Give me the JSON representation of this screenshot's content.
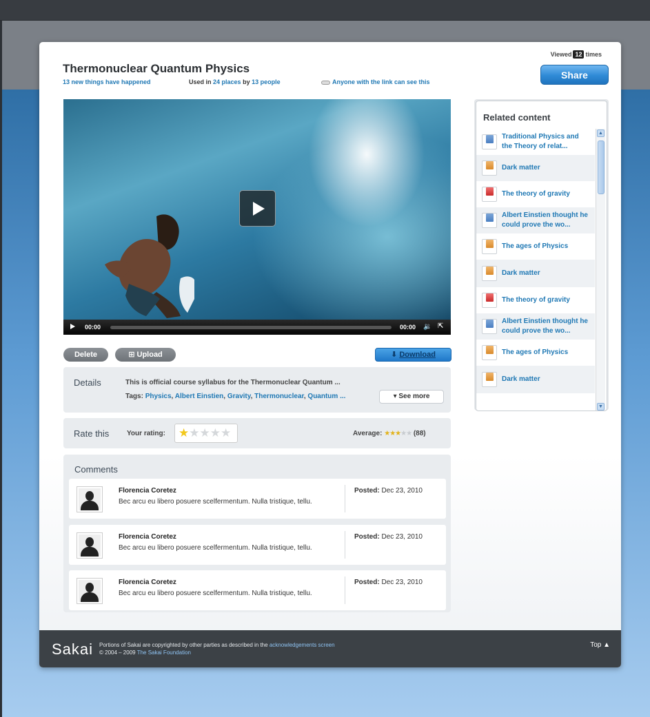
{
  "header": {
    "title": "Thermonuclear Quantum Physics",
    "new_things": "13 new things have happened",
    "used_in_prefix": "Used in",
    "used_in_places": "24 places",
    "used_by_prefix": "by",
    "used_by_people": "13 people",
    "visibility": "Anyone with the link can see this",
    "viewed_prefix": "Viewed",
    "viewed_count": "12",
    "viewed_suffix": "times",
    "share_label": "Share"
  },
  "video": {
    "current_time": "00:00",
    "duration": "00:00",
    "progress": 0
  },
  "actions": {
    "delete_label": "Delete",
    "upload_label": "Upload",
    "download_label": "Download"
  },
  "details": {
    "label": "Details",
    "description": "This is official course syllabus for the Thermonuclear Quantum ...",
    "tags_label": "Tags:",
    "tags": [
      "Physics",
      "Albert Einstien",
      "Gravity",
      "Thermonuclear",
      "Quantum ..."
    ],
    "see_more_label": "See more"
  },
  "rating": {
    "label": "Rate this",
    "your_rating_label": "Your rating:",
    "your_rating": 1,
    "max_rating": 5,
    "average_label": "Average:",
    "average": 3,
    "count": "(88)"
  },
  "comments": {
    "label": "Comments",
    "items": [
      {
        "author": "Florencia Coretez",
        "text": "Bec arcu eu libero posuere scelfermentum. Nulla tristique, tellu.",
        "posted_label": "Posted:",
        "date": "Dec 23, 2010"
      },
      {
        "author": "Florencia Coretez",
        "text": "Bec arcu eu libero posuere scelfermentum. Nulla tristique, tellu.",
        "posted_label": "Posted:",
        "date": "Dec 23, 2010"
      },
      {
        "author": "Florencia Coretez",
        "text": "Bec arcu eu libero posuere scelfermentum. Nulla tristique, tellu.",
        "posted_label": "Posted:",
        "date": "Dec 23, 2010"
      }
    ]
  },
  "related": {
    "title": "Related content",
    "items": [
      {
        "label": "Traditional Physics and the Theory of relat...",
        "icon": "doc-icon"
      },
      {
        "label": "Dark matter",
        "icon": "presentation-icon"
      },
      {
        "label": "The theory of gravity",
        "icon": "pdf-icon"
      },
      {
        "label": "Albert Einstien thought he could prove the wo...",
        "icon": "doc-icon"
      },
      {
        "label": "The ages of Physics",
        "icon": "presentation-icon"
      },
      {
        "label": "Dark matter",
        "icon": "presentation-icon"
      },
      {
        "label": "The theory of gravity",
        "icon": "pdf-icon"
      },
      {
        "label": "Albert Einstien thought he could prove the wo...",
        "icon": "doc-icon"
      },
      {
        "label": "The ages of Physics",
        "icon": "presentation-icon"
      },
      {
        "label": "Dark matter",
        "icon": "presentation-icon"
      }
    ]
  },
  "footer": {
    "logo": "Sakai",
    "text_prefix": "Portions of Sakai are copyrighted by other parties as described in the",
    "ack_link": "acknowledgements screen",
    "copyright": "© 2004 – 2009",
    "foundation_link": "The Sakai Foundation",
    "top_label": "Top"
  },
  "colors": {
    "accent": "#1f78b4",
    "share_button": "#2f8ad6",
    "star_on": "#f2c81b",
    "footer_bg": "#3c4146"
  }
}
